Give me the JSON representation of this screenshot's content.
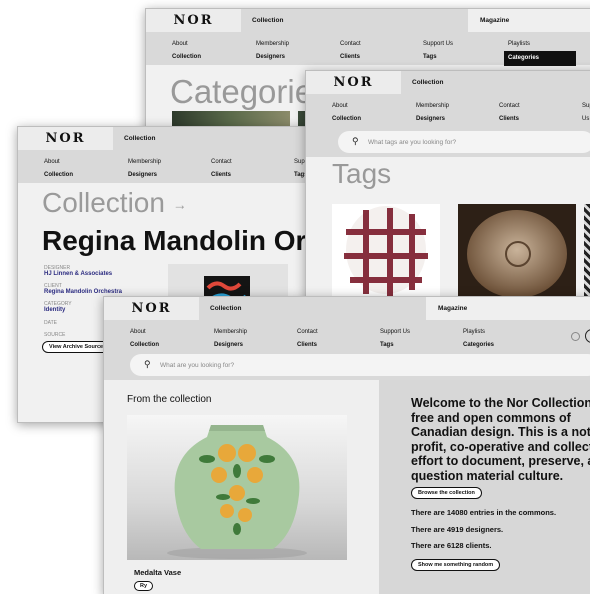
{
  "logo": "NOR",
  "nav": {
    "top_collection": "Collection",
    "top_magazine": "Magazine",
    "cols": [
      {
        "label": "About",
        "sub": "Collection"
      },
      {
        "label": "Membership",
        "sub": "Designers"
      },
      {
        "label": "Contact",
        "sub": "Clients"
      },
      {
        "label": "Support Us",
        "sub": "Tags"
      },
      {
        "label": "Playlists",
        "sub": "Categories"
      }
    ]
  },
  "search": {
    "placeholder": "What are you looking for?",
    "tags_placeholder": "What tags are you looking for?"
  },
  "categories_page": {
    "title": "Categories"
  },
  "tags_page": {
    "title": "Tags"
  },
  "collection_page": {
    "title": "Collection",
    "arrow": "→",
    "name": "Regina Mandolin Orchestra",
    "meta": [
      {
        "label": "DESIGNER",
        "value": "HJ Linnen & Associates"
      },
      {
        "label": "CLIENT",
        "value": "Regina Mandolin Orchestra"
      },
      {
        "label": "CATEGORY",
        "value": "Identity"
      },
      {
        "label": "DATE",
        "value": ""
      },
      {
        "label": "SOURCE",
        "value": ""
      }
    ],
    "view_source_button": "View Archive Source"
  },
  "home": {
    "from_collection": "From the collection",
    "item_name": "Medalta Vase",
    "item_tag": "Ry",
    "welcome": "Welcome to the Nor Collection, a free and open commons of Canadian design. This is a not-for-profit, co-operative and collective effort to document, preserve, and question material culture.",
    "browse_button": "Browse the collection",
    "stats": [
      "There are 14080 entries  in the commons.",
      "There are 4919 designers.",
      "There are 6128 clients."
    ],
    "random_button": "Show me something random"
  },
  "colors": {
    "background": "#ffffff",
    "chrome": "#d9d9d9",
    "panel": "#f1f1f1",
    "accent": "#111111",
    "link": "#2b2b80"
  }
}
